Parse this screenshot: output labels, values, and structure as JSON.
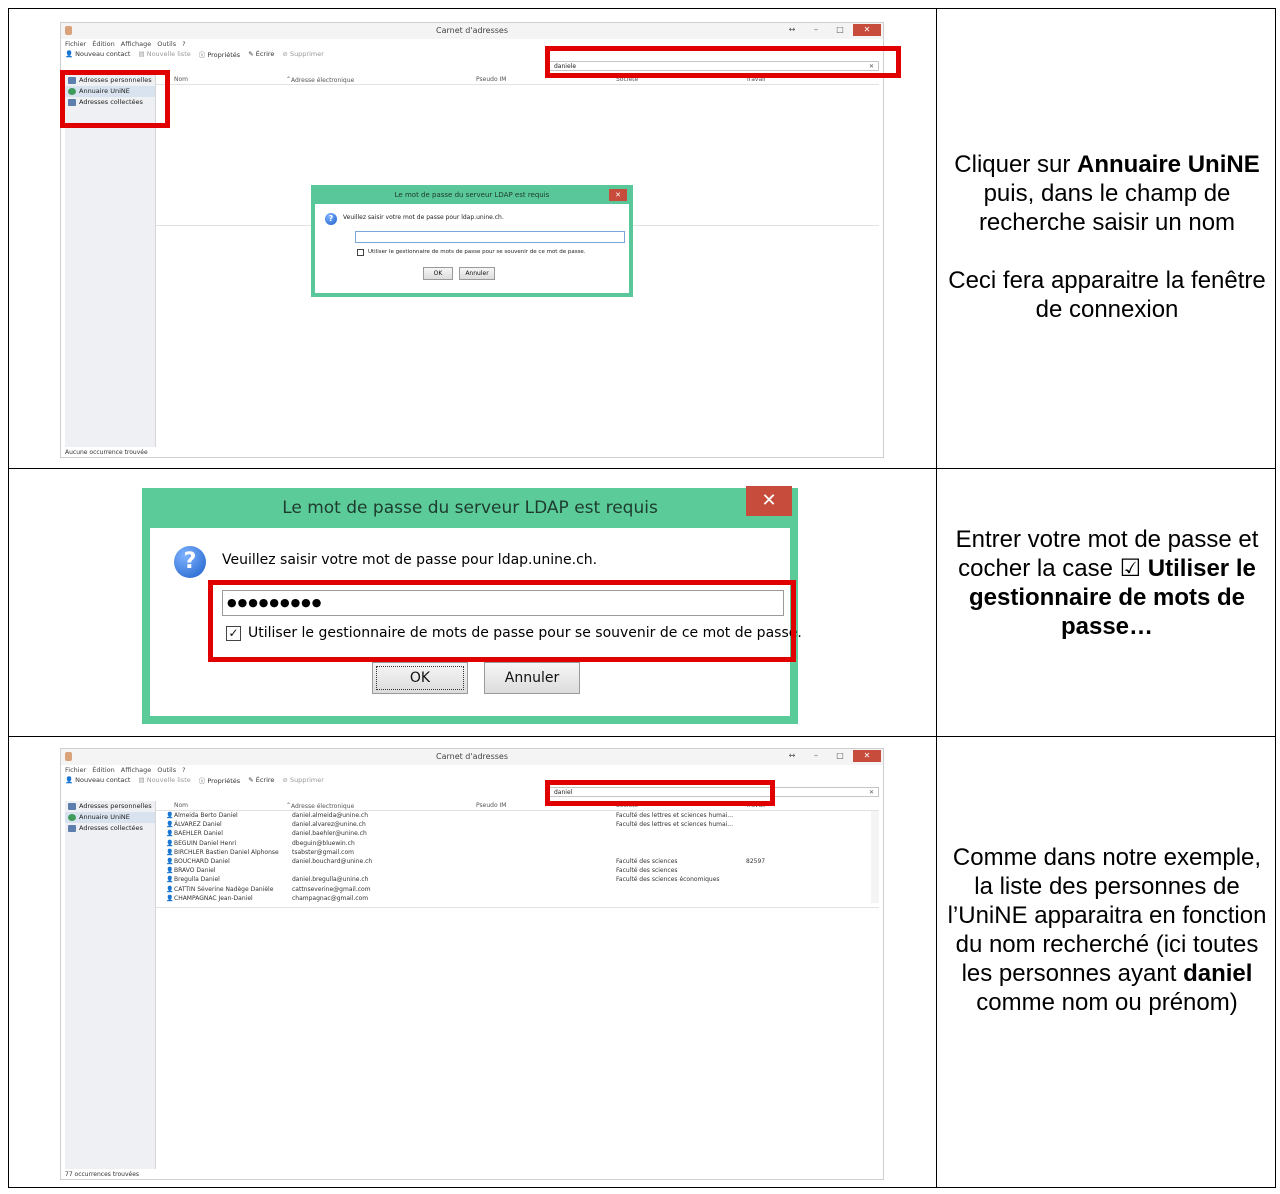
{
  "app": {
    "title": "Carnet d'adresses",
    "menu": [
      "Fichier",
      "Édition",
      "Affichage",
      "Outils",
      "?"
    ],
    "toolbar": {
      "new_contact": "Nouveau contact",
      "new_list": "Nouvelle liste",
      "properties": "Propriétés",
      "write": "Écrire",
      "delete": "Supprimer"
    },
    "sidebar": [
      "Adresses personnelles",
      "Annuaire UniNE",
      "Adresses collectées"
    ],
    "columns": {
      "name": "Nom",
      "email": "Adresse électronique",
      "im": "Pseudo IM",
      "company": "Société",
      "work": "Travail"
    }
  },
  "step1": {
    "search_value": "daniele",
    "status": "Aucune occurrence trouvée",
    "caption_a": "Cliquer sur ",
    "caption_bold": "Annuaire UniNE",
    "caption_b": " puis, dans le champ de recherche saisir un nom",
    "caption_c": "Ceci fera apparaitre la fenêtre de connexion"
  },
  "dialog": {
    "title": "Le mot de passe du serveur LDAP est requis",
    "message": "Veuillez saisir votre mot de passe pour ldap.unine.ch.",
    "password_mask": "●●●●●●●●●",
    "checkbox_label": "Utiliser le gestionnaire de mots de passe pour se souvenir de ce mot de passe.",
    "ok": "OK",
    "cancel": "Annuler",
    "close": "✕"
  },
  "step2": {
    "caption_a": "Entrer votre mot de passe et cocher la case ☑ ",
    "caption_bold": "Utiliser le gestionnaire de mots de passe…"
  },
  "step3": {
    "search_value": "daniel",
    "status": "77 occurrences trouvées",
    "rows": [
      {
        "name": "Almeida Berto Daniel",
        "email": "daniel.almeida@unine.ch",
        "company": "Faculté des lettres et sciences humai...",
        "work": ""
      },
      {
        "name": "ÁLVAREZ Daniel",
        "email": "daniel.alvarez@unine.ch",
        "company": "Faculté des lettres et sciences humai...",
        "work": ""
      },
      {
        "name": "BAEHLER Daniel",
        "email": "daniel.baehler@unine.ch",
        "company": "",
        "work": ""
      },
      {
        "name": "BEGUIN Daniel Henri",
        "email": "dbeguin@bluewin.ch",
        "company": "",
        "work": ""
      },
      {
        "name": "BIRCHLER Bastien Daniel Alphonse",
        "email": "tsabster@gmail.com",
        "company": "",
        "work": ""
      },
      {
        "name": "BOUCHARD Daniel",
        "email": "daniel.bouchard@unine.ch",
        "company": "Faculté des sciences",
        "work": "82597"
      },
      {
        "name": "BRAVO Daniel",
        "email": "",
        "company": "Faculté des sciences",
        "work": ""
      },
      {
        "name": "Bregulla Daniel",
        "email": "daniel.bregulla@unine.ch",
        "company": "Faculté des sciences économiques",
        "work": ""
      },
      {
        "name": "CATTIN Séverine Nadège Danièle",
        "email": "cattnseverine@gmail.com",
        "company": "",
        "work": ""
      },
      {
        "name": "CHAMPAGNAC Jean-Daniel",
        "email": "champagnac@gmail.com",
        "company": "",
        "work": ""
      }
    ],
    "caption_a": "Comme dans notre exemple, la liste des personnes de l’UniNE apparaitra en fonction du nom recherché (ici toutes les personnes ayant ",
    "caption_bold": "daniel",
    "caption_b": " comme nom ou prénom)"
  }
}
